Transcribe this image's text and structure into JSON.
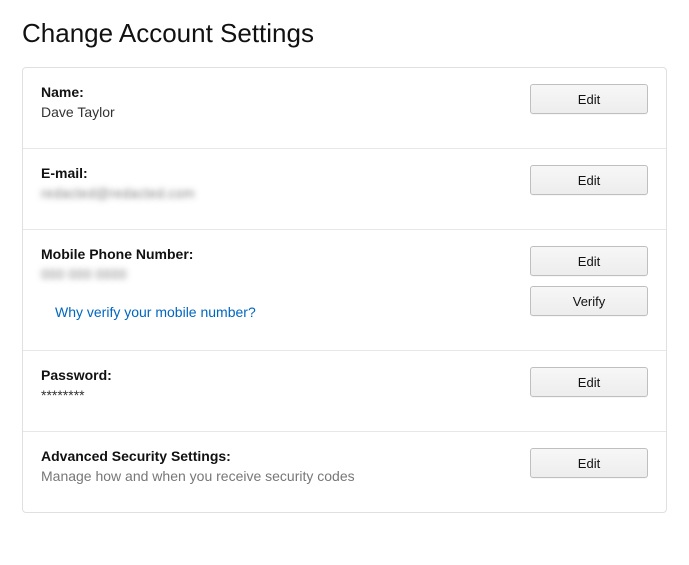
{
  "page": {
    "title": "Change Account Settings"
  },
  "buttons": {
    "edit": "Edit",
    "verify": "Verify"
  },
  "name": {
    "label": "Name:",
    "value": "Dave Taylor"
  },
  "email": {
    "label": "E-mail:",
    "value": "redacted@redacted.com"
  },
  "mobile": {
    "label": "Mobile Phone Number:",
    "value": "000 000 0000",
    "verify_link": "Why verify your mobile number?"
  },
  "password": {
    "label": "Password:",
    "value": "********"
  },
  "advanced": {
    "label": "Advanced Security Settings:",
    "subtext": "Manage how and when you receive security codes"
  }
}
